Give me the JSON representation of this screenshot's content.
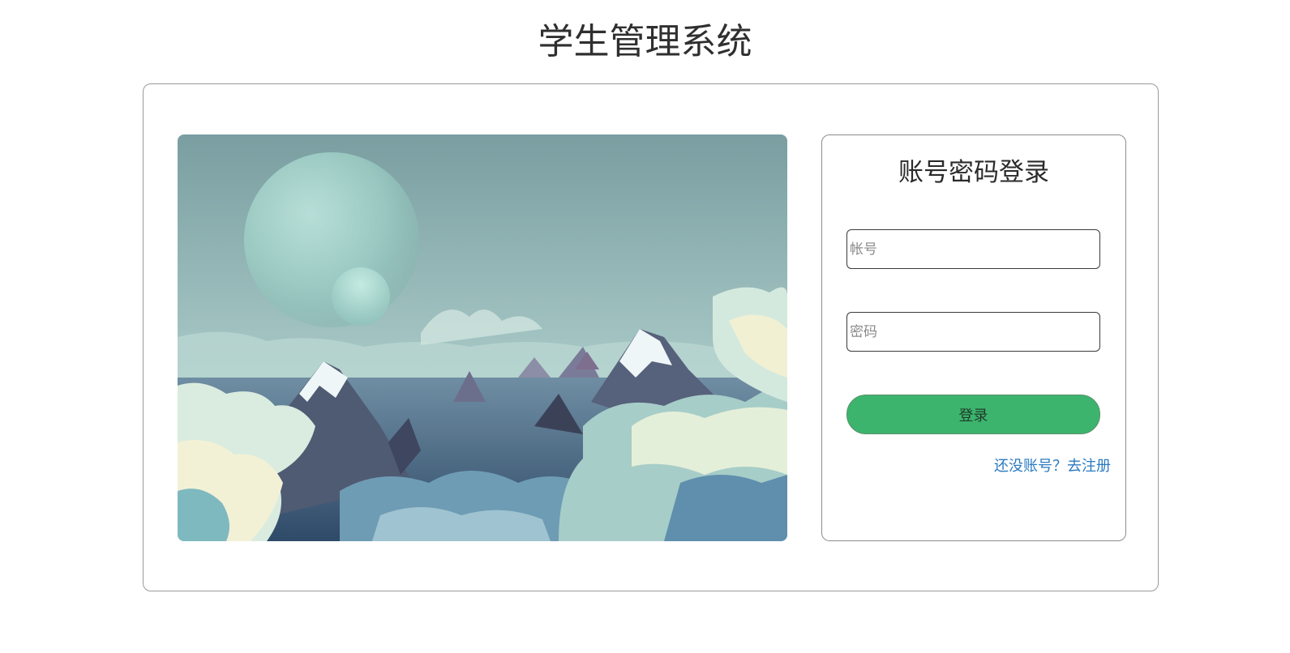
{
  "page": {
    "title": "学生管理系统"
  },
  "login": {
    "title": "账号密码登录",
    "username_placeholder": "帐号",
    "username_value": "",
    "password_placeholder": "密码",
    "password_value": "",
    "submit_label": "登录",
    "register_link": "还没账号？去注册"
  },
  "colors": {
    "accent_button": "#3cb46e",
    "link": "#2a7ac0",
    "title_text": "#2f2f2f"
  },
  "icons": {
    "scene_image": "mountain-cloud-landscape-illustration"
  }
}
